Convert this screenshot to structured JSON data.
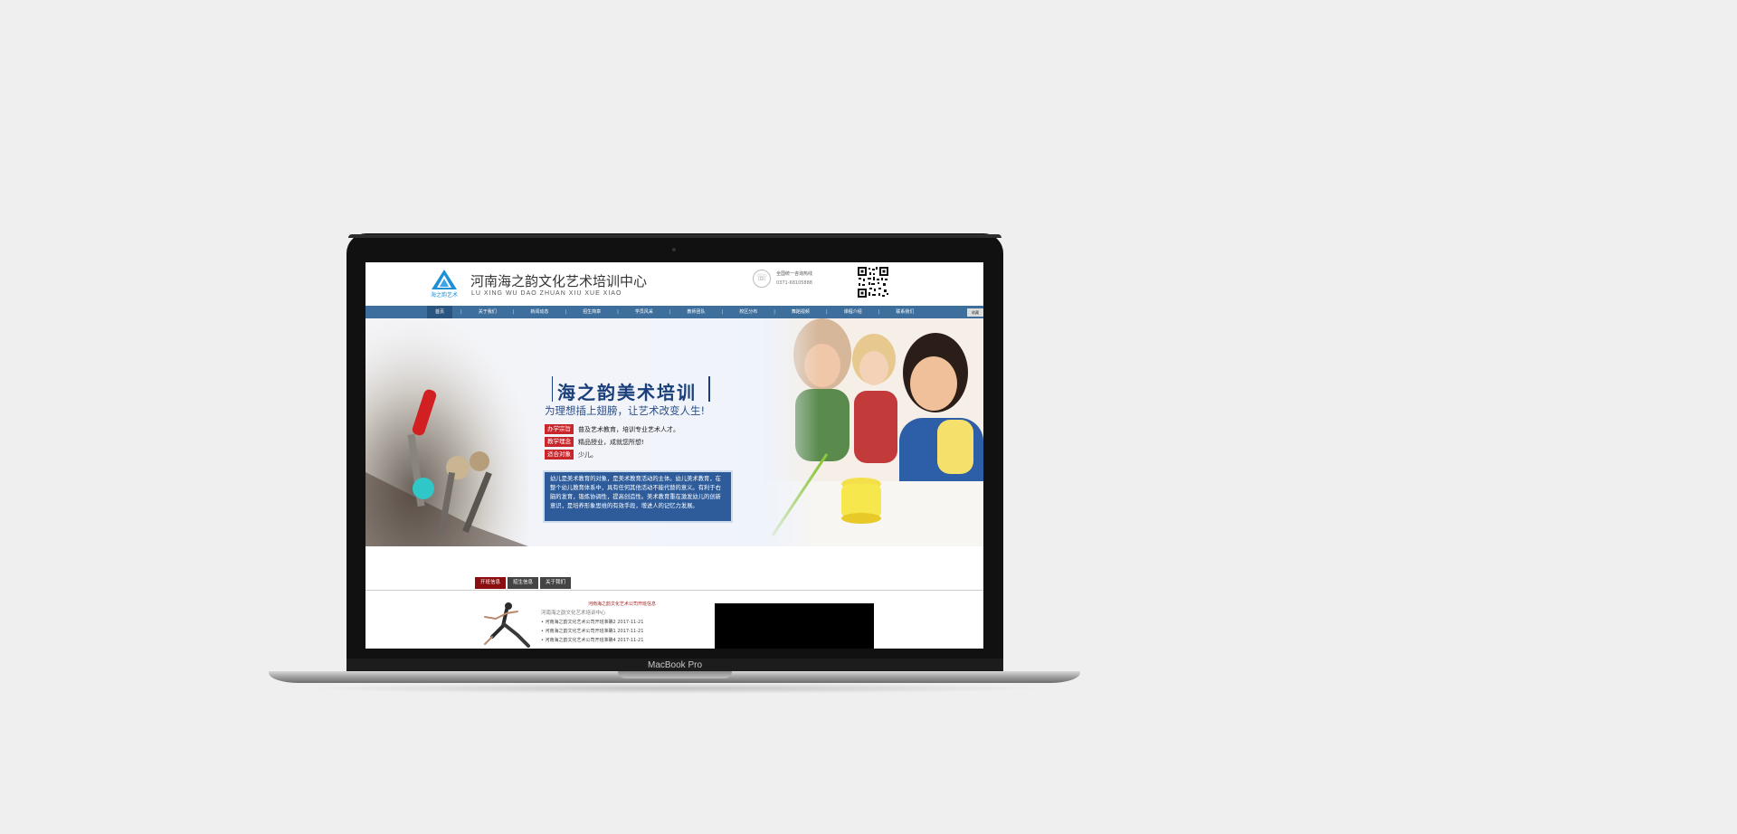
{
  "laptop": {
    "model": "MacBook Pro"
  },
  "site": {
    "title": "河南海之韵文化艺术培训中心",
    "subtitle": "LU XING WU DAO ZHUAN XIU XUE XIAO",
    "logo_text": "海之韵艺术",
    "hotline_label": "全国统一咨询热线",
    "hotline_number": "0371-68105888"
  },
  "nav": {
    "items": [
      "首页",
      "关于我们",
      "新闻动态",
      "招生简章",
      "学员风采",
      "教师团队",
      "校区分布",
      "舞蹈视频",
      "课程介绍",
      "联系我们"
    ],
    "separator": "|",
    "flag": "收藏"
  },
  "banner": {
    "title": "海之韵美术培训",
    "slogan": "为理想插上翅膀，让艺术改变人生!",
    "tags": [
      {
        "label": "办学宗旨",
        "text": "普及艺术教育，培训专业艺术人才。"
      },
      {
        "label": "教学理念",
        "text": "精品授业，成就您所想!"
      },
      {
        "label": "适合对象",
        "text": "少儿。"
      }
    ],
    "intro": "幼儿是美术教育的对象，是美术教育活动的主体。幼儿美术教育，在整个幼儿教育体系中，具有任何其他活动不能代替的意义。有利于右脑的发育，锻炼协调性，提高创造性。美术教育重在激发幼儿的创新意识，是培养形象思维的有效手段，增进人的记忆力发展。"
  },
  "tabs": [
    "开班信息",
    "招生信息",
    "关于我们"
  ],
  "news": {
    "title": "河南海之韵文化艺术公司开班信息",
    "subtitle": "河南海之韵文化艺术培训中心",
    "items": [
      {
        "text": "• 河南海之韵文化艺术公司开班准确2",
        "date": "2017-11-21"
      },
      {
        "text": "• 河南海之韵文化艺术公司开班准确1",
        "date": "2017-11-21"
      },
      {
        "text": "• 河南海之韵文化艺术公司开班准确4",
        "date": "2017-11-21"
      }
    ]
  },
  "colors": {
    "nav": "#3d6e9c",
    "active_tab": "#8b0e10",
    "banner_title": "#1a3f7a",
    "tag": "#c9262c",
    "intro_box": "#2e5c9a"
  }
}
